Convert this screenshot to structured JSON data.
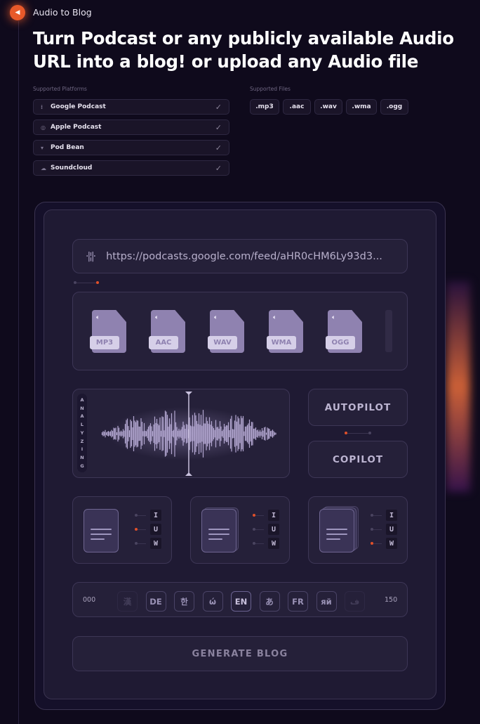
{
  "header": {
    "app_title": "Audio to Blog",
    "headline": "Turn Podcast or any publicly available Audio URL into a blog! or upload any Audio file",
    "logo_icon": "speaker-icon",
    "accent": "#e8592a"
  },
  "platforms": {
    "label": "Supported Platforms",
    "items": [
      {
        "label": "Google Podcast",
        "icon": "google-podcast-icon"
      },
      {
        "label": "Apple Podcast",
        "icon": "apple-podcast-icon"
      },
      {
        "label": "Pod Bean",
        "icon": "podbean-icon"
      },
      {
        "label": "Soundcloud",
        "icon": "soundcloud-icon"
      }
    ]
  },
  "files": {
    "label": "Supported Files",
    "items": [
      ".mp3",
      ".aac",
      ".wav",
      ".wma",
      ".ogg"
    ]
  },
  "url_input": {
    "value": "https://podcasts.google.com/feed/aHR0cHM6Ly93d3..."
  },
  "formats": [
    "MP3",
    "AAC",
    "WAV",
    "WMA",
    "OGG"
  ],
  "analyzer": {
    "label": "ANALYZING"
  },
  "modes": {
    "autopilot": "AUTOPILOT",
    "copilot": "COPILOT",
    "selected": "autopilot"
  },
  "documents": [
    {
      "options": [
        "I",
        "U",
        "W"
      ],
      "selected": "U"
    },
    {
      "options": [
        "I",
        "U",
        "W"
      ],
      "selected": "I"
    },
    {
      "options": [
        "I",
        "U",
        "W"
      ],
      "selected": "W"
    }
  ],
  "languages": {
    "start": "000",
    "end": "150",
    "items": [
      "漢",
      "DE",
      "한",
      "ώ",
      "EN",
      "あ",
      "FR",
      "яй",
      "ف"
    ],
    "selected": "EN"
  },
  "generate_label": "GENERATE BLOG"
}
